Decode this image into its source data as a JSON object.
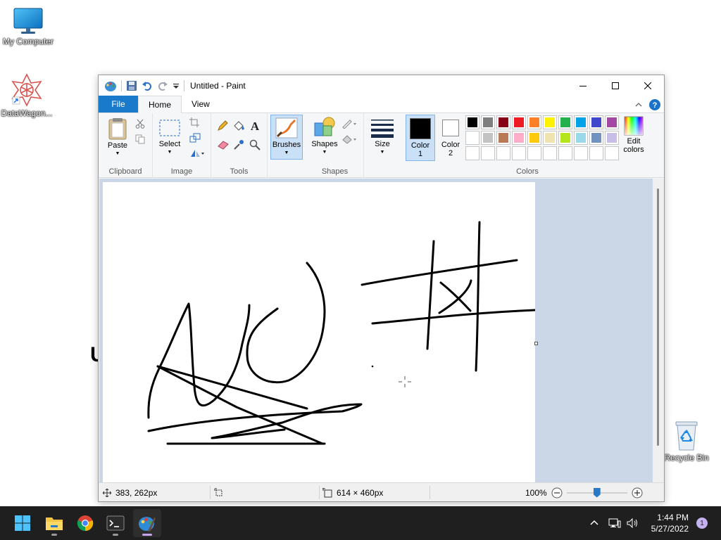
{
  "desktop": {
    "icons": [
      {
        "label": "My Computer",
        "icon": "monitor-icon"
      },
      {
        "label": "DataWagon...",
        "icon": "datawagon-shortcut-icon"
      },
      {
        "label": "Recycle Bin",
        "icon": "recycle-bin-icon"
      }
    ],
    "stray_text": "U"
  },
  "window": {
    "title": "Untitled - Paint",
    "tabs": {
      "file": "File",
      "home": "Home",
      "view": "View"
    },
    "ribbon": {
      "clipboard": {
        "paste": "Paste",
        "group": "Clipboard"
      },
      "image": {
        "select": "Select",
        "group": "Image"
      },
      "tools": {
        "group": "Tools"
      },
      "brushes": {
        "label": "Brushes"
      },
      "shapes": {
        "label": "Shapes",
        "group": "Shapes"
      },
      "size": {
        "label": "Size"
      },
      "color1": {
        "label": "Color",
        "num": "1",
        "value": "#000000"
      },
      "color2": {
        "label": "Color",
        "num": "2",
        "value": "#ffffff"
      },
      "edit_colors": {
        "line1": "Edit",
        "line2": "colors"
      },
      "colors_group": "Colors",
      "palette_row1": [
        "#000000",
        "#7f7f7f",
        "#880015",
        "#ed1c24",
        "#ff7f27",
        "#fff200",
        "#22b14c",
        "#00a2e8",
        "#3f48cc",
        "#a349a4"
      ],
      "palette_row2": [
        "#ffffff",
        "#c3c3c3",
        "#b97a57",
        "#ffaec9",
        "#ffc90e",
        "#efe4b0",
        "#b5e61d",
        "#99d9ea",
        "#7092be",
        "#c8bfe7"
      ]
    },
    "status": {
      "cursor_pos": "383, 262px",
      "canvas_size": "614 × 460px",
      "zoom": "100%",
      "zoom_level": 0.5
    }
  },
  "taskbar": {
    "apps": [
      "start-icon",
      "file-explorer-icon",
      "chrome-icon",
      "terminal-icon",
      "paint-icon"
    ],
    "time": "1:44 PM",
    "date": "5/27/2022",
    "notifications": "1"
  }
}
